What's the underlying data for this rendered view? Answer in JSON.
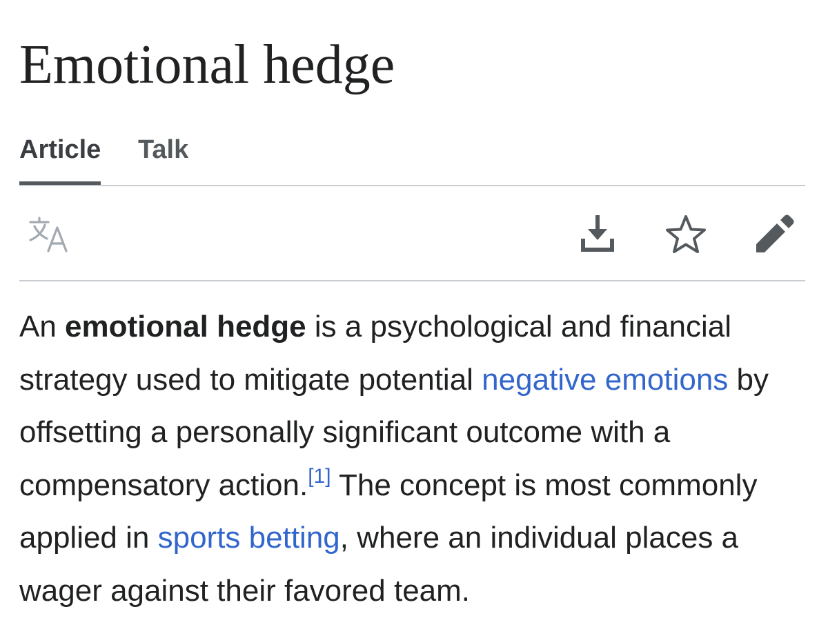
{
  "page": {
    "title": "Emotional hedge"
  },
  "tabs": [
    {
      "label": "Article",
      "selected": true
    },
    {
      "label": "Talk",
      "selected": false
    }
  ],
  "toolbar": {
    "icons": [
      "language-icon",
      "download-icon",
      "star-icon",
      "edit-icon"
    ]
  },
  "article": {
    "intro": {
      "t1": "An ",
      "bold": "emotional hedge",
      "t2": " is a psychological and financial strategy used to mitigate potential ",
      "link1": "negative emotions",
      "t3": " by offsetting a personally significant outcome with a compensatory action.",
      "ref": "[1]",
      "t4": " The concept is most commonly applied in ",
      "link2": "sports betting",
      "t5": ", where an individual places a wager against their favored team."
    }
  },
  "colors": {
    "link": "#3366cc",
    "text": "#202122",
    "divider": "#c8ccd1",
    "icon": "#54595d",
    "icon_muted": "#a2a9b1"
  }
}
